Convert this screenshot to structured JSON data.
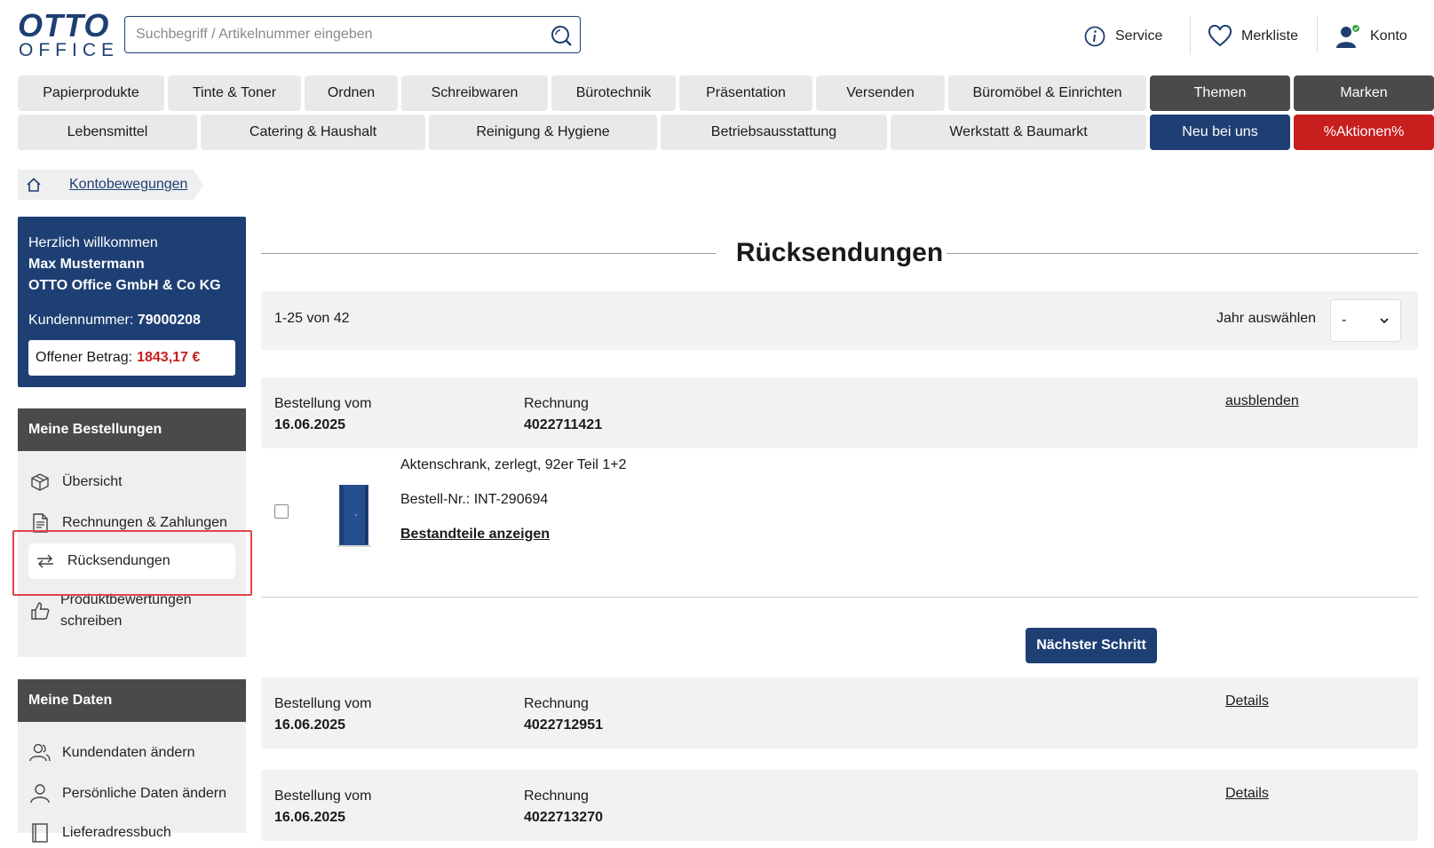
{
  "header": {
    "logo_top": "OTTO",
    "logo_bottom": "OFFICE",
    "search_placeholder": "Suchbegriff / Artikelnummer eingeben",
    "links": {
      "service": "Service",
      "wishlist": "Merkliste",
      "account": "Konto"
    }
  },
  "nav": {
    "row1": [
      "Papierprodukte",
      "Tinte & Toner",
      "Ordnen",
      "Schreibwaren",
      "Bürotechnik",
      "Präsentation",
      "Versenden",
      "Büromöbel & Einrichten",
      "Themen",
      "Marken"
    ],
    "row2": [
      "Lebensmittel",
      "Catering & Haushalt",
      "Reinigung & Hygiene",
      "Betriebsausstattung",
      "Werkstatt & Baumarkt",
      "Neu bei uns",
      "%Aktionen%"
    ]
  },
  "breadcrumb": {
    "current": "Kontobewegungen"
  },
  "welcome": {
    "greeting": "Herzlich willkommen",
    "name": "Max Mustermann",
    "company": "OTTO Office GmbH & Co KG",
    "customer_label": "Kundennummer:",
    "customer_number": "79000208",
    "open_label": "Offener Betrag:",
    "open_amount": "1843,17 €"
  },
  "orders_menu": {
    "title": "Meine Bestellungen",
    "overview": "Übersicht",
    "invoices": "Rechnungen & Zahlungen",
    "returns": "Rücksendungen",
    "reviews_line1": "Produktbewertungen",
    "reviews_line2": "schreiben"
  },
  "data_menu": {
    "title": "Meine Daten",
    "customer_data": "Kundendaten ändern",
    "personal_data": "Persönliche Daten ändern",
    "address_book": "Lieferadressbuch"
  },
  "page": {
    "title": "Rücksendungen",
    "count": "1-25 von 42",
    "year_label": "Jahr auswählen",
    "year_value": "-",
    "next_step": "Nächster Schritt"
  },
  "orders": [
    {
      "date_label": "Bestellung vom",
      "date": "16.06.2025",
      "invoice_label": "Rechnung",
      "invoice": "4022711421",
      "action": "ausblenden"
    },
    {
      "date_label": "Bestellung vom",
      "date": "16.06.2025",
      "invoice_label": "Rechnung",
      "invoice": "4022712951",
      "action": "Details"
    },
    {
      "date_label": "Bestellung vom",
      "date": "16.06.2025",
      "invoice_label": "Rechnung",
      "invoice": "4022713270",
      "action": "Details"
    }
  ],
  "product": {
    "name": "Aktenschrank, zerlegt, 92er Teil 1+2",
    "article": "Bestell-Nr.: INT-290694",
    "parts_link": "Bestandteile anzeigen"
  },
  "colors": {
    "brand_blue": "#1e3f73",
    "sale_red": "#c81e1e",
    "dark_gray": "#4a4a4a",
    "highlight": "#e0464b"
  }
}
